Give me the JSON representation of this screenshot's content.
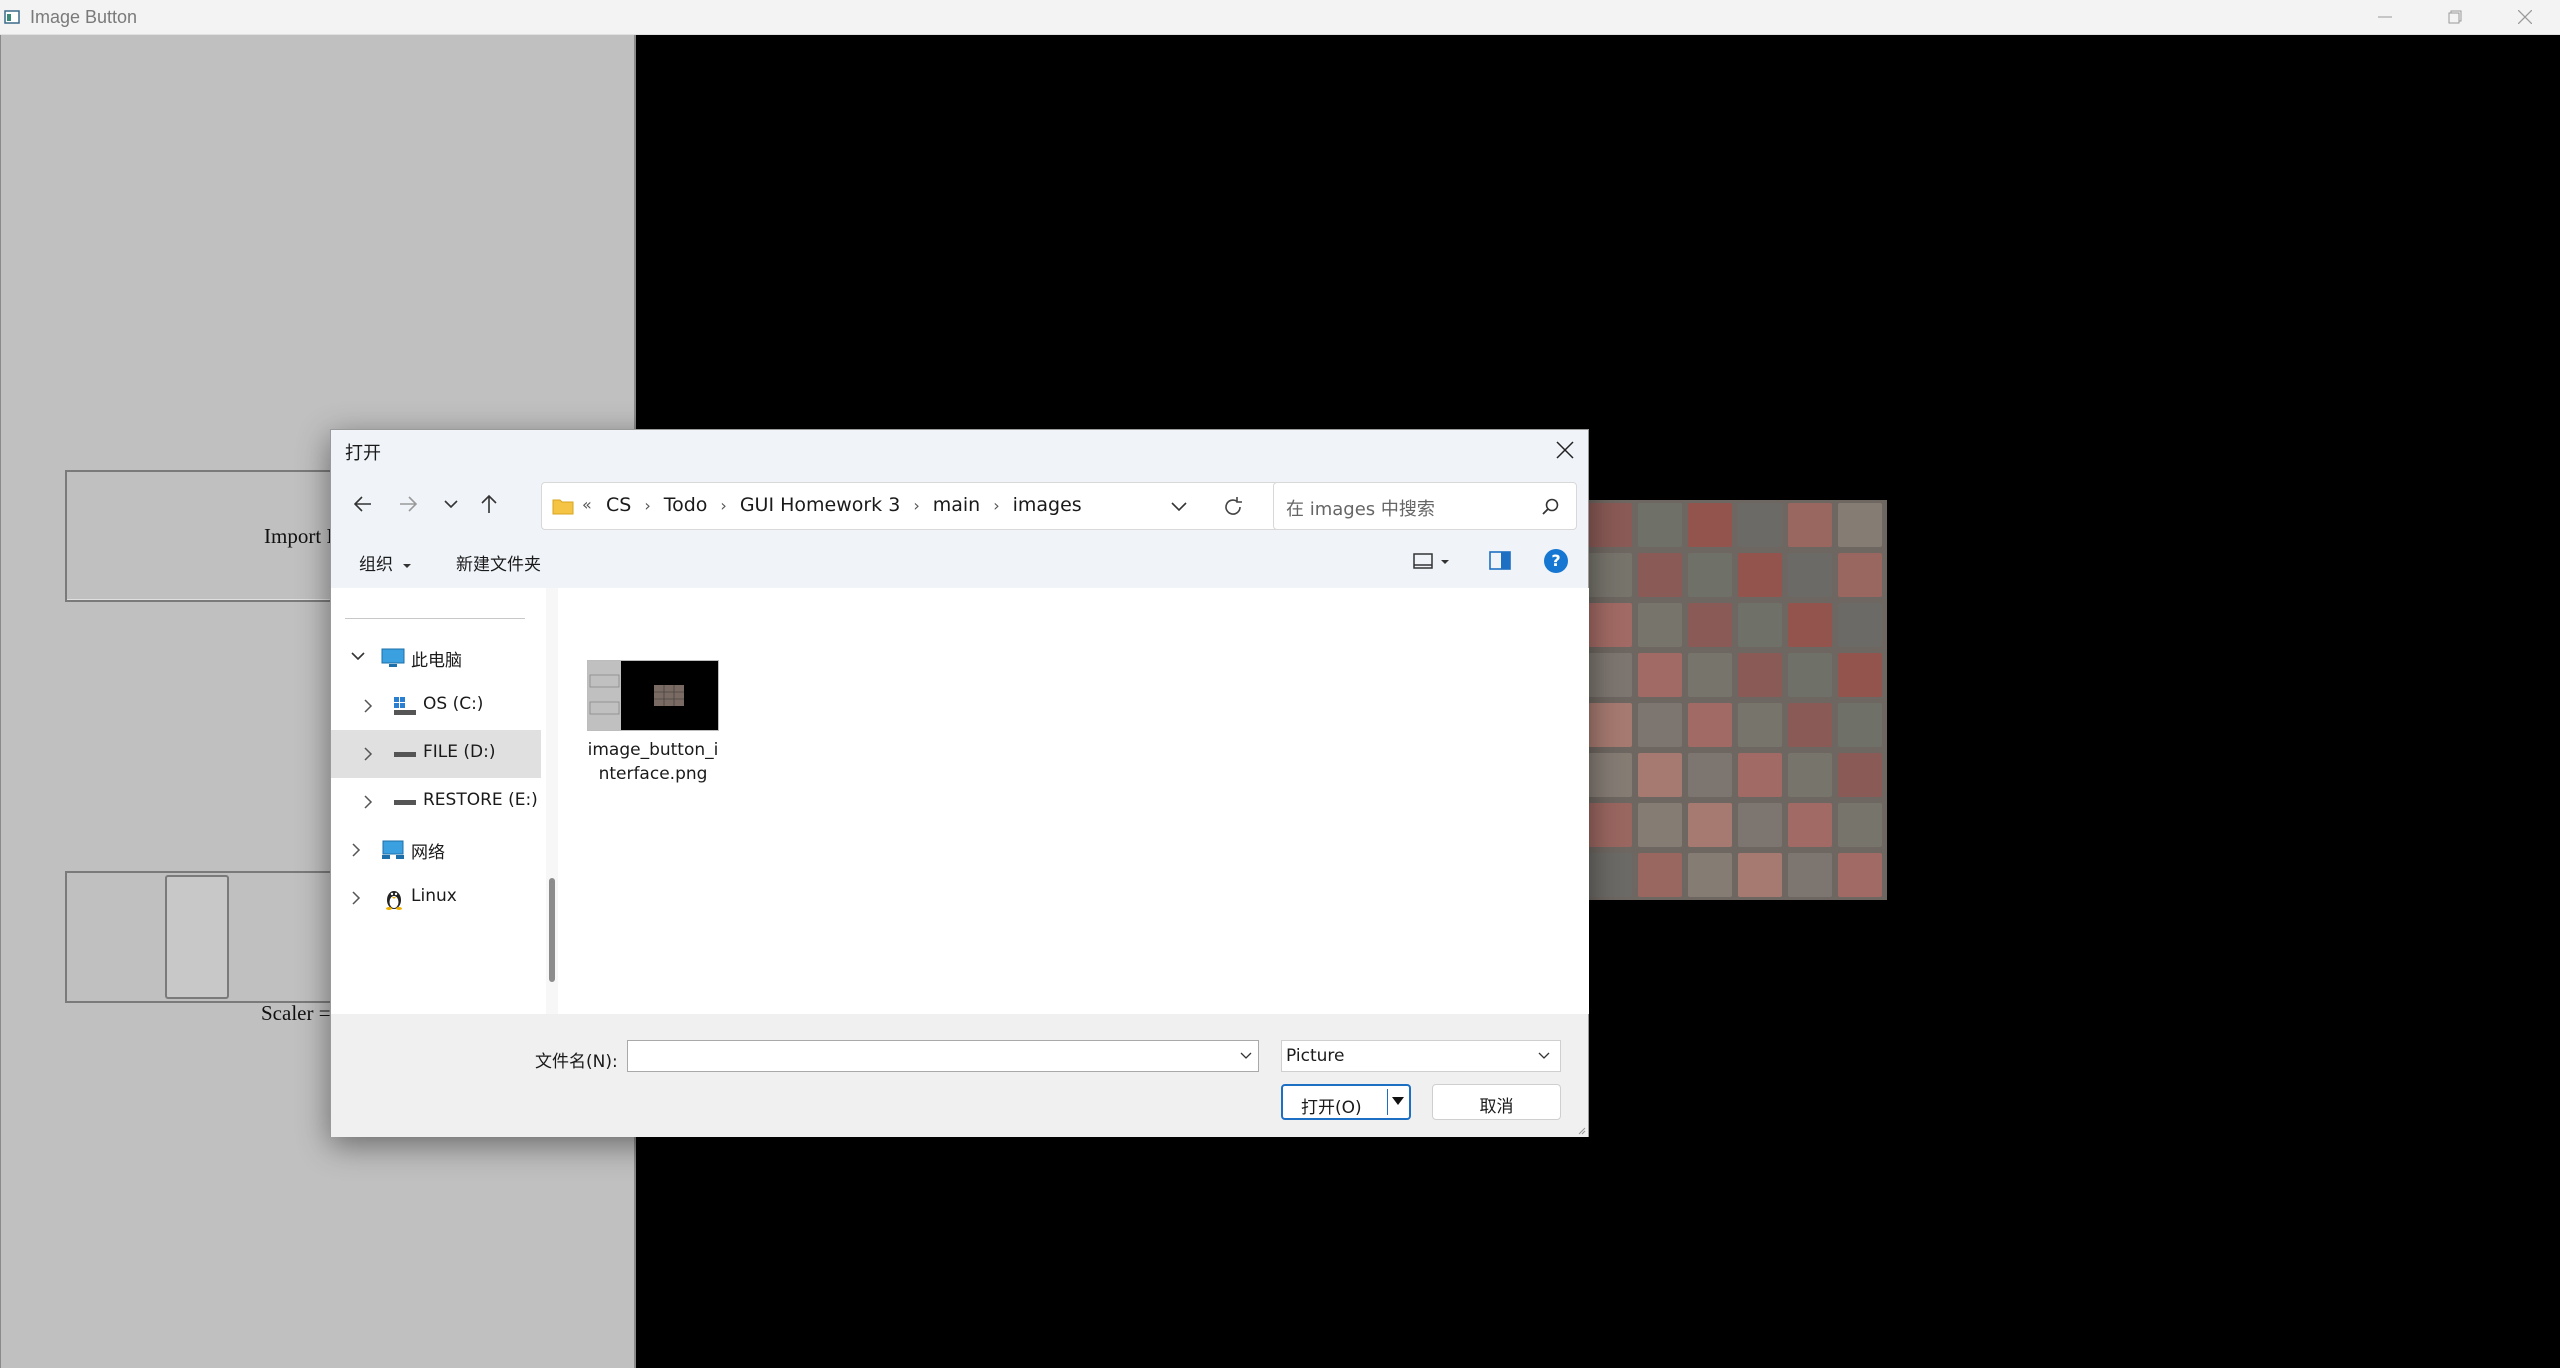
{
  "window": {
    "title": "Image Button",
    "icon": "app-window-icon",
    "controls": [
      "minimize-icon",
      "maximize-icon",
      "close-icon"
    ]
  },
  "left_panel": {
    "import_button_label": "Import Image",
    "scaler_label": "Scaler = 1",
    "background": "#c0c0c0"
  },
  "dialog": {
    "title": "打开",
    "address": {
      "overflow": "«",
      "breadcrumb": [
        "CS",
        "Todo",
        "GUI Homework 3",
        "main",
        "images"
      ],
      "separator": "›"
    },
    "search_placeholder": "在 images 中搜索",
    "toolbar": {
      "organize": "组织",
      "new_folder": "新建文件夹",
      "help": "?"
    },
    "nav_tree": [
      {
        "label": "此电脑",
        "icon": "this-pc-icon",
        "level": 0,
        "expanded": true
      },
      {
        "label": "OS (C:)",
        "icon": "windows-drive-icon",
        "level": 1
      },
      {
        "label": "FILE (D:)",
        "icon": "drive-icon",
        "level": 1,
        "selected": true
      },
      {
        "label": "RESTORE (E:)",
        "icon": "drive-icon",
        "level": 1
      },
      {
        "label": "网络",
        "icon": "network-icon",
        "level": 0
      },
      {
        "label": "Linux",
        "icon": "linux-penguin-icon",
        "level": 0
      }
    ],
    "files": [
      {
        "name_line1": "image_button_i",
        "name_line2": "nterface.png"
      }
    ],
    "filename_label": "文件名(N):",
    "filename_value": "",
    "filetype_value": "Picture",
    "open_button": "打开(O)",
    "cancel_button": "取消"
  },
  "colors": {
    "accent": "#1d6fc4",
    "help": "#1677d2",
    "dialog_chrome": "#f0f4f9"
  }
}
